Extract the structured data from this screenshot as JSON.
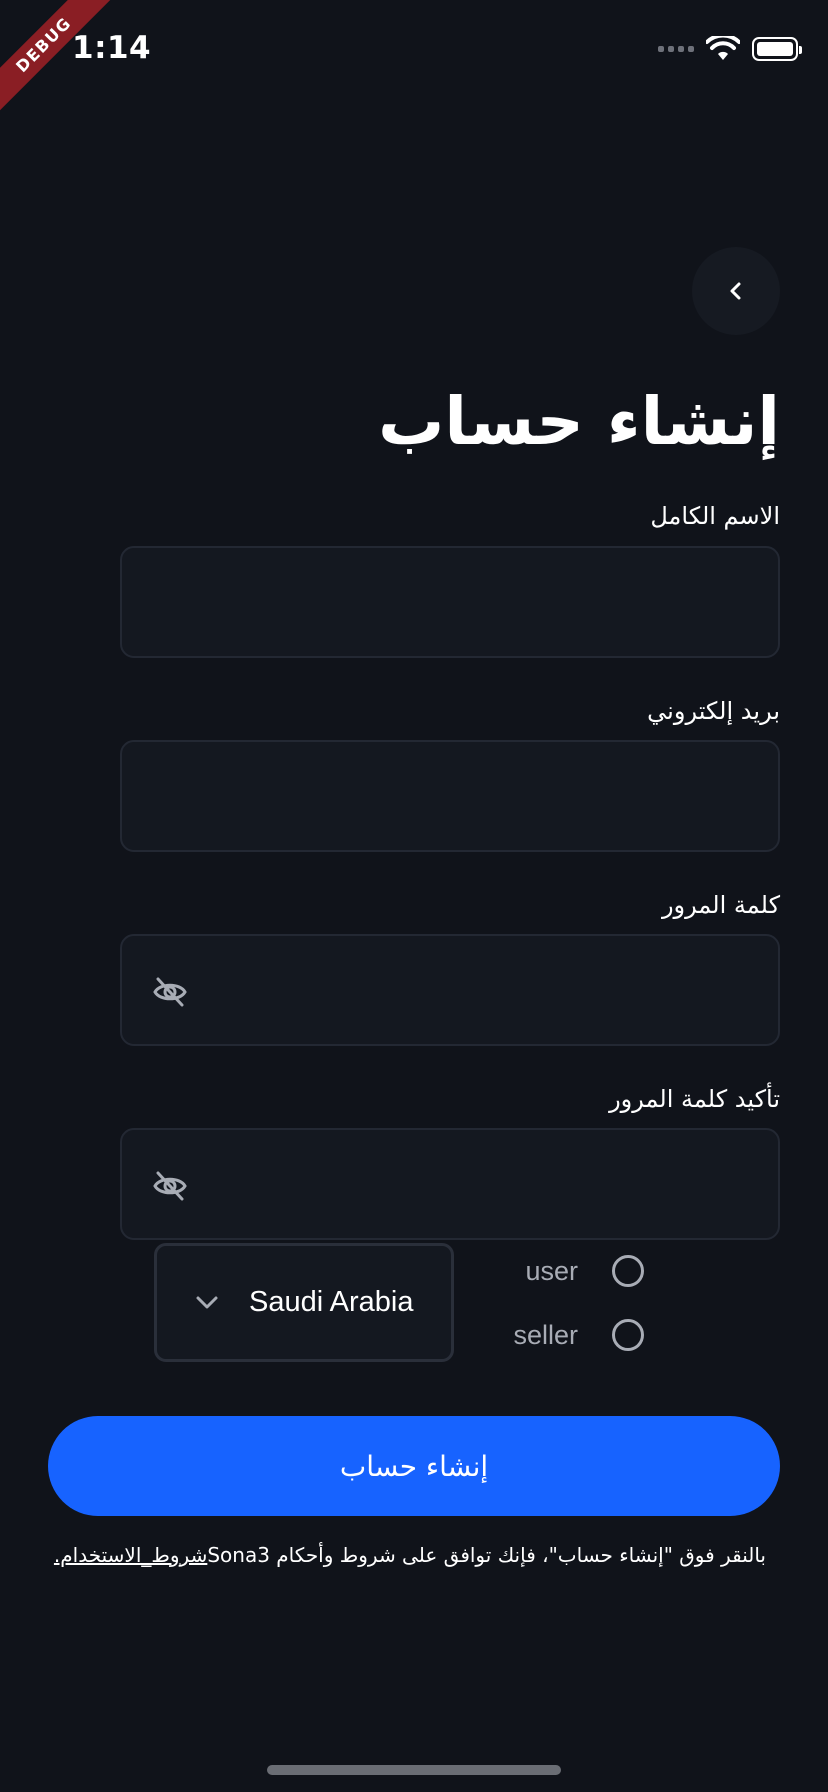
{
  "status_bar": {
    "time": "1:14",
    "debug_label": "DEBUG"
  },
  "header": {
    "title": "إنشاء حساب",
    "back_icon": "chevron-left-icon"
  },
  "form": {
    "full_name": {
      "label": "الاسم الكامل",
      "value": ""
    },
    "email": {
      "label": "بريد إلكتروني",
      "value": ""
    },
    "password": {
      "label": "كلمة المرور",
      "value": "",
      "icon": "eye-off-icon"
    },
    "confirm_password": {
      "label": "تأكيد كلمة المرور",
      "value": "",
      "icon": "eye-off-icon"
    },
    "country": {
      "selected": "Saudi Arabia",
      "icon": "chevron-down-icon"
    },
    "role_options": [
      {
        "label": "user",
        "selected": false
      },
      {
        "label": "seller",
        "selected": false
      }
    ]
  },
  "submit_label": "إنشاء حساب",
  "terms": {
    "prefix": "بالنقر فوق \"إنشاء حساب\"، فإنك توافق على شروط وأحكام Sona3",
    "link": "شروط_الاستخدام."
  },
  "colors": {
    "background": "#10131A",
    "accent": "#1763FF",
    "field_border": "#232833"
  }
}
